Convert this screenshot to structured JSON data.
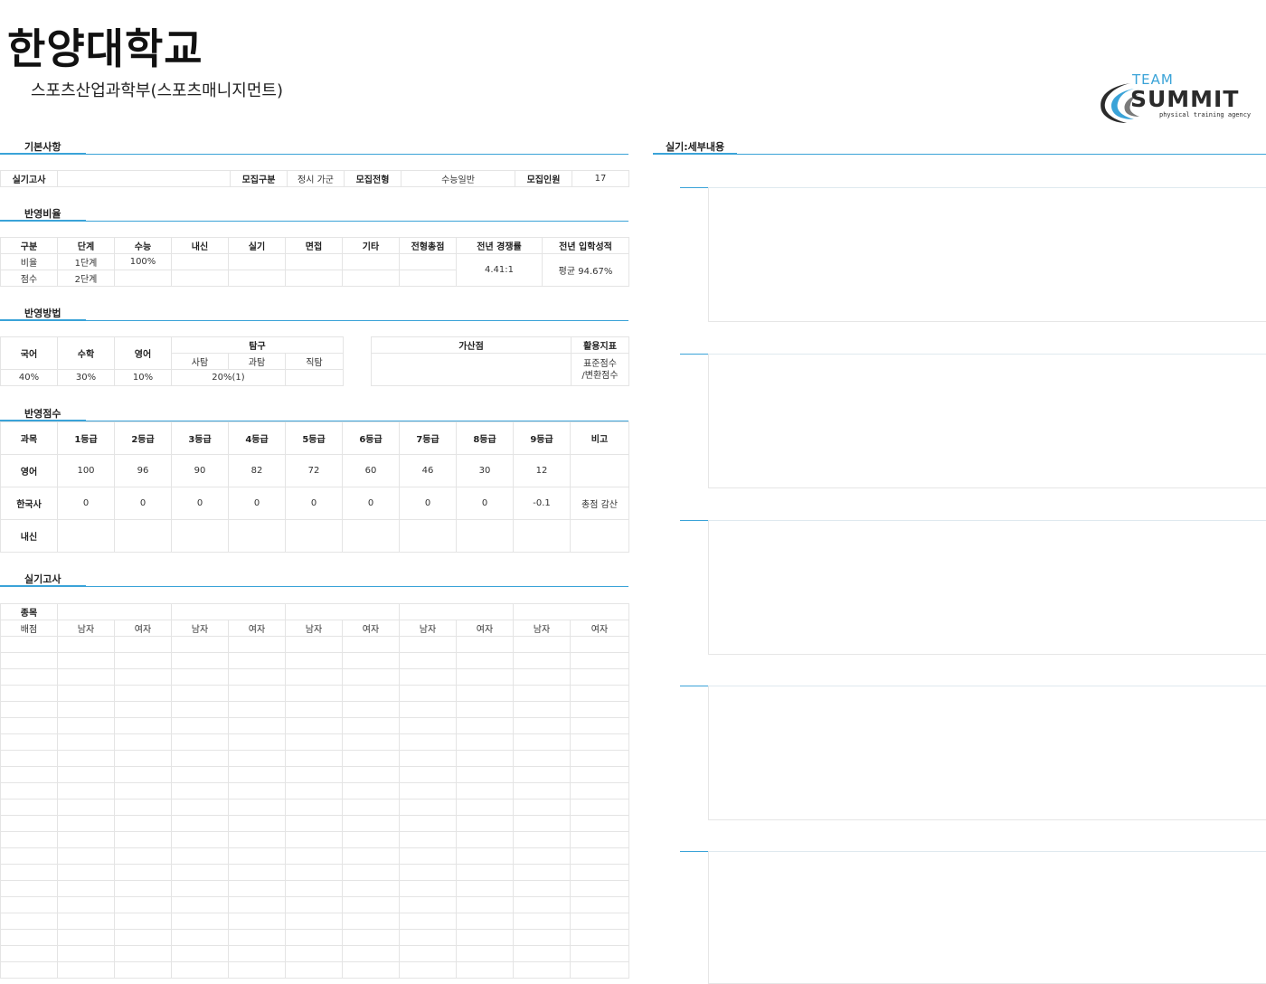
{
  "header": {
    "university": "한양대학교",
    "department": "스포츠산업과학부(스포츠매니지먼트)"
  },
  "logo": {
    "team": "TEAM",
    "name": "SUMMIT",
    "tagline": "physical training agency",
    "colors": {
      "accent": "#3aa3d8",
      "dark": "#2b2b2b"
    }
  },
  "sections": {
    "basic": "기본사항",
    "ratio": "반영비율",
    "method": "반영방법",
    "score": "반영점수",
    "practical": "실기고사",
    "detail": "실기:세부내용"
  },
  "basic": {
    "exam_label": "실기고사",
    "exam_value": "",
    "type_label": "모집구분",
    "type_value": "정시 가군",
    "track_label": "모집전형",
    "track_value": "수능일반",
    "quota_label": "모집인원",
    "quota_value": "17"
  },
  "ratio": {
    "headers": [
      "구분",
      "단계",
      "수능",
      "내신",
      "실기",
      "면접",
      "기타",
      "전형총점",
      "전년 경쟁률",
      "전년 입학성적"
    ],
    "row1": [
      "비율",
      "1단계",
      "100%",
      "",
      "",
      "",
      "",
      ""
    ],
    "row2": [
      "점수",
      "2단계",
      "",
      "",
      "",
      "",
      "",
      ""
    ],
    "competition": "4.41:1",
    "admission": "평균 94.67%"
  },
  "method": {
    "headers": {
      "korean": "국어",
      "math": "수학",
      "english": "영어",
      "explore": "탐구",
      "bonus": "가산점",
      "index": "활용지표"
    },
    "explore_sub": [
      "사탐",
      "과탐",
      "직탐"
    ],
    "values": {
      "korean": "40%",
      "math": "30%",
      "english": "10%",
      "explore": "20%(1)",
      "bonus": ""
    },
    "index_value": [
      "표준점수",
      "/변환점수"
    ]
  },
  "score": {
    "headers": [
      "과목",
      "1등급",
      "2등급",
      "3등급",
      "4등급",
      "5등급",
      "6등급",
      "7등급",
      "8등급",
      "9등급",
      "비고"
    ],
    "rows": [
      [
        "영어",
        "100",
        "96",
        "90",
        "82",
        "72",
        "60",
        "46",
        "30",
        "12",
        ""
      ],
      [
        "한국사",
        "0",
        "0",
        "0",
        "0",
        "0",
        "0",
        "0",
        "0",
        "-0.1",
        "총점 감산"
      ],
      [
        "내신",
        "",
        "",
        "",
        "",
        "",
        "",
        "",
        "",
        "",
        ""
      ]
    ]
  },
  "practical": {
    "event_label": "종목",
    "points_label": "배점",
    "genders": [
      "남자",
      "여자",
      "남자",
      "여자",
      "남자",
      "여자",
      "남자",
      "여자",
      "남자",
      "여자"
    ]
  }
}
